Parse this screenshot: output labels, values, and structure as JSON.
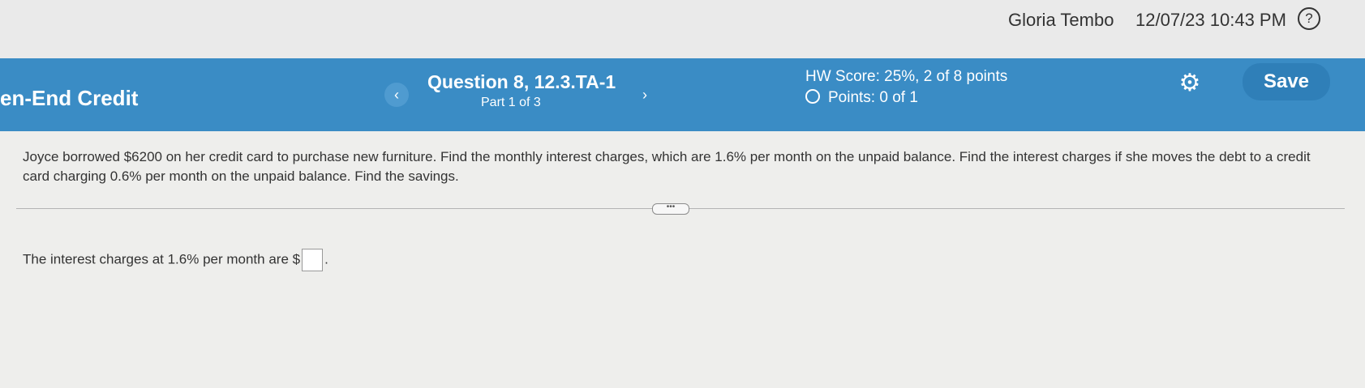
{
  "topbar": {
    "user_name": "Gloria Tembo",
    "timestamp": "12/07/23 10:43 PM",
    "help_icon": "?"
  },
  "header": {
    "course_title": "en-End Credit",
    "question_title": "Question 8, 12.3.TA-1",
    "part": "Part 1 of 3",
    "prev_icon": "‹",
    "next_icon": "›",
    "hw_score": "HW Score: 25%, 2 of 8 points",
    "points": "Points: 0 of 1",
    "save_label": "Save",
    "accent_color": "#3a8cc5"
  },
  "question": {
    "text": "Joyce borrowed $6200 on her credit card to purchase new furniture. Find the monthly interest charges, which are 1.6% per month on the unpaid balance. Find the interest charges if she moves the debt to a credit card charging 0.6% per month on the unpaid balance. Find the savings.",
    "expand_label": "•••"
  },
  "answer": {
    "prefix": "The interest charges at 1.6% per month are $",
    "suffix": ".",
    "value": ""
  }
}
